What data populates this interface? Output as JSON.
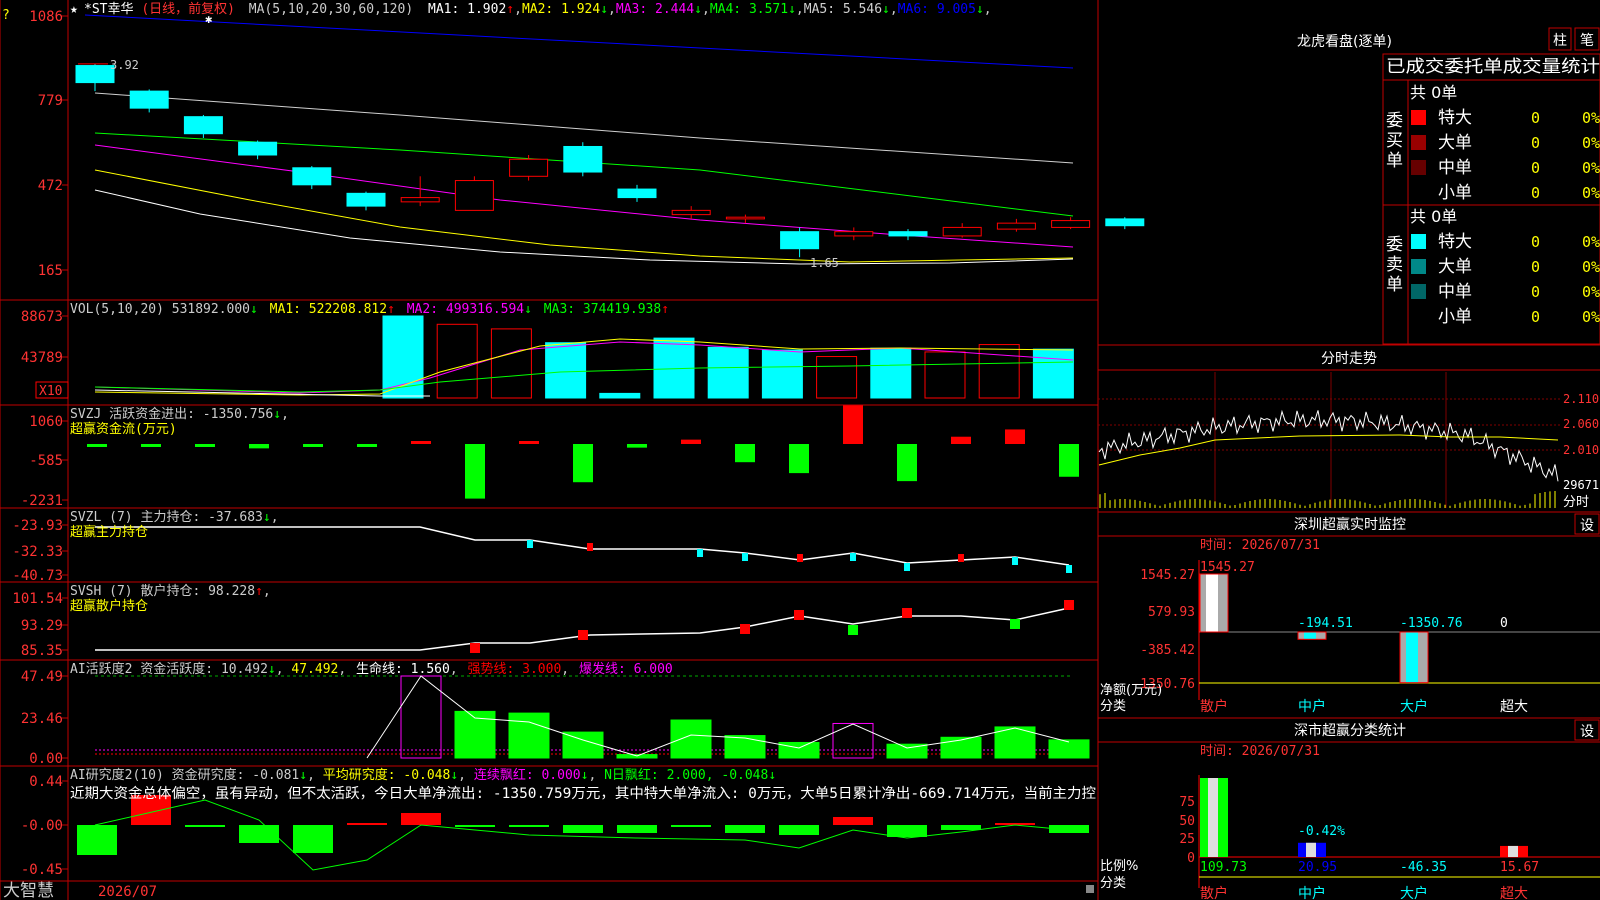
{
  "stock": {
    "star": "★",
    "name": "*ST幸华",
    "period": "(日线，前复权)",
    "ma_header": "MA(5,10,20,30,60,120)",
    "ma": [
      {
        "label": "MA1: 1.902",
        "arrow": "↑",
        "color": "#ffffff"
      },
      {
        "label": "MA2: 1.924",
        "arrow": "↓",
        "color": "#ffff00"
      },
      {
        "label": "MA3: 2.444",
        "arrow": "↓",
        "color": "#ff00ff"
      },
      {
        "label": "MA4: 3.571",
        "arrow": "↓",
        "color": "#00ff00"
      },
      {
        "label": "MA5: 5.546",
        "arrow": "↓",
        "color": "#d0d0d0"
      },
      {
        "label": "MA6: 9.005",
        "arrow": "↓",
        "color": "#0000ff"
      }
    ],
    "y_ticks": [
      "1086",
      "779",
      "472",
      "165"
    ],
    "high_label": "3.92",
    "low_label": "1.65"
  },
  "candles": [
    {
      "o": 3.9,
      "c": 3.7,
      "h": 3.92,
      "l": 3.6
    },
    {
      "o": 3.6,
      "c": 3.4,
      "h": 3.62,
      "l": 3.35
    },
    {
      "o": 3.3,
      "c": 3.1,
      "h": 3.32,
      "l": 3.05
    },
    {
      "o": 3.0,
      "c": 2.85,
      "h": 3.02,
      "l": 2.8
    },
    {
      "o": 2.7,
      "c": 2.5,
      "h": 2.72,
      "l": 2.45
    },
    {
      "o": 2.4,
      "c": 2.25,
      "h": 2.42,
      "l": 2.2
    },
    {
      "o": 2.3,
      "c": 2.35,
      "h": 2.6,
      "l": 2.25
    },
    {
      "o": 2.2,
      "c": 2.55,
      "h": 2.6,
      "l": 2.2
    },
    {
      "o": 2.6,
      "c": 2.8,
      "h": 2.85,
      "l": 2.55
    },
    {
      "o": 2.95,
      "c": 2.65,
      "h": 3.0,
      "l": 2.6
    },
    {
      "o": 2.45,
      "c": 2.35,
      "h": 2.5,
      "l": 2.3
    },
    {
      "o": 2.15,
      "c": 2.2,
      "h": 2.25,
      "l": 2.1
    },
    {
      "o": 2.1,
      "c": 2.12,
      "h": 2.15,
      "l": 2.05
    },
    {
      "o": 1.95,
      "c": 1.75,
      "h": 2.0,
      "l": 1.65
    },
    {
      "o": 1.9,
      "c": 1.95,
      "h": 2.0,
      "l": 1.85
    },
    {
      "o": 1.95,
      "c": 1.9,
      "h": 1.98,
      "l": 1.85
    },
    {
      "o": 1.9,
      "c": 2.0,
      "h": 2.05,
      "l": 1.88
    },
    {
      "o": 1.98,
      "c": 2.05,
      "h": 2.1,
      "l": 1.95
    },
    {
      "o": 2.0,
      "c": 2.08,
      "h": 2.12,
      "l": 1.98
    },
    {
      "o": 2.1,
      "c": 2.02,
      "h": 2.12,
      "l": 1.98
    }
  ],
  "vol": {
    "label": "VOL(5,10,20) 531892.000",
    "arrow0": "↓",
    "ma1": "MA1: 522208.812",
    "ma1_arrow": "↑",
    "ma2": "MA2: 499316.594",
    "ma2_arrow": "↓",
    "ma3": "MA3: 374419.938",
    "ma3_arrow": "↑",
    "ticks": [
      "88673",
      "43789"
    ],
    "unit": "X10",
    "bars": [
      {
        "v": 0,
        "up": false
      },
      {
        "v": 0,
        "up": false
      },
      {
        "v": 0,
        "up": false
      },
      {
        "v": 0,
        "up": false
      },
      {
        "v": 0,
        "up": false
      },
      {
        "v": 0,
        "up": false
      },
      {
        "v": 89000,
        "up": false
      },
      {
        "v": 80000,
        "up": true
      },
      {
        "v": 75000,
        "up": true
      },
      {
        "v": 60000,
        "up": false
      },
      {
        "v": 5000,
        "up": false
      },
      {
        "v": 65000,
        "up": false
      },
      {
        "v": 55000,
        "up": false
      },
      {
        "v": 52000,
        "up": false
      },
      {
        "v": 45000,
        "up": true
      },
      {
        "v": 54000,
        "up": false
      },
      {
        "v": 50000,
        "up": true
      },
      {
        "v": 58000,
        "up": true
      },
      {
        "v": 53000,
        "up": false
      }
    ]
  },
  "svzj": {
    "label": "SVZJ  活跃资金进出: -1350.756",
    "arrow": "↓",
    "subtitle": "超赢资金流(万元)",
    "ticks": [
      "1060",
      "-585",
      "-2231"
    ],
    "bars": [
      -80,
      -50,
      -60,
      -150,
      -60,
      -40,
      0,
      120,
      60,
      200,
      -1400,
      180,
      -1500,
      -300,
      350,
      -1100,
      -1200,
      1060,
      -1400,
      400,
      700,
      -1350
    ]
  },
  "svzl": {
    "label": "SVZL (7) 主力持仓: -37.683",
    "arrow": "↓",
    "subtitle": "超赢主力持仓",
    "ticks": [
      "-23.93",
      "-32.33",
      "-40.73"
    ]
  },
  "svsh": {
    "label": "SVSH (7) 散户持仓: 98.228",
    "arrow": "↑",
    "subtitle": "超赢散户持仓",
    "ticks": [
      "101.54",
      "93.29",
      "85.35"
    ]
  },
  "ai_active": {
    "label": "AI活跃度2 资金活跃度: 10.492",
    "arrow": "↓",
    "v2": "47.492",
    "life": "生命线: 1.560",
    "strong": "强势线: 3.000",
    "burst": "爆发线: 6.000",
    "ticks": [
      "47.49",
      "23.46",
      "0.00"
    ]
  },
  "ai_research": {
    "label": "AI研究度2(10) 资金研究度: -0.081",
    "arrow": "↓",
    "avg": "平均研究度: -0.048",
    "avg_arrow": "↓",
    "red": "连续飘红: 0.000",
    "red_arrow": "↓",
    "nday": "N日飘红: 2.000, -0.048",
    "nday_arrow": "↓",
    "comment": "近期大资金总体偏空，虽有异动，但不太活跃，今日大单净流出: -1350.759万元，其中特大单净流入: 0万元，大单5日累计净出-669.714万元，当前主力控",
    "ticks": [
      "0.44",
      "-0.00",
      "-0.45"
    ]
  },
  "footer": {
    "brand": "大智慧",
    "date": "2026/07"
  },
  "lhb": {
    "title": "龙虎看盘(逐单)",
    "btn1": "柱",
    "btn2": "笔",
    "header": "已成交委托单成交量统计",
    "buy_side": "委买单",
    "sell_side": "委卖单",
    "buy_total": "共 0单",
    "sell_total": "共 0单",
    "buy_rows": [
      {
        "name": "特大",
        "count": "0",
        "pct": "0%",
        "color": "#ff0000"
      },
      {
        "name": "大单",
        "count": "0",
        "pct": "0%",
        "color": "#990000"
      },
      {
        "name": "中单",
        "count": "0",
        "pct": "0%",
        "color": "#660000"
      },
      {
        "name": "小单",
        "count": "0",
        "pct": "0%",
        "color": ""
      }
    ],
    "sell_rows": [
      {
        "name": "特大",
        "count": "0",
        "pct": "0%",
        "color": "#00ffff"
      },
      {
        "name": "大单",
        "count": "0",
        "pct": "0%",
        "color": "#008888"
      },
      {
        "name": "中单",
        "count": "0",
        "pct": "0%",
        "color": "#006666"
      },
      {
        "name": "小单",
        "count": "0",
        "pct": "0%",
        "color": ""
      }
    ]
  },
  "intraday": {
    "title": "分时走势",
    "ticks": [
      "2.110",
      "2.060",
      "2.010"
    ],
    "vol": "29671",
    "tag": "分时"
  },
  "sz_monitor": {
    "title": "深圳超赢实时监控",
    "btn": "设",
    "time": "时间: 2026/07/31",
    "ticks": [
      "1545.27",
      "579.93",
      "-385.42",
      "-1350.76"
    ],
    "bar_labels": [
      "1545.27",
      "-194.51",
      "-1350.76",
      "0"
    ],
    "values": [
      1545.27,
      -194.51,
      -1350.76,
      0
    ],
    "ylabel": "净额(万元)",
    "xlabel": "分类",
    "cats": [
      "散户",
      "中户",
      "大户",
      "超大"
    ]
  },
  "sz_class": {
    "title": "深市超赢分类统计",
    "btn": "设",
    "time": "时间: 2026/07/31",
    "ticks": [
      "75",
      "50",
      "25",
      "0"
    ],
    "pct_label": "-0.42%",
    "values_text": [
      "109.73",
      "20.95",
      "-46.35",
      "15.67"
    ],
    "bar_pct": [
      100,
      18,
      0,
      14
    ],
    "ylabel": "比例%",
    "xlabel": "分类",
    "cats": [
      "散户",
      "中户",
      "大户",
      "超大"
    ]
  },
  "chart_data": {
    "type": "bar",
    "title": "深圳超赢实时监控",
    "ylabel": "净额(万元)",
    "categories": [
      "散户",
      "中户",
      "大户",
      "超大"
    ],
    "values": [
      1545.27,
      -194.51,
      -1350.76,
      0
    ]
  }
}
